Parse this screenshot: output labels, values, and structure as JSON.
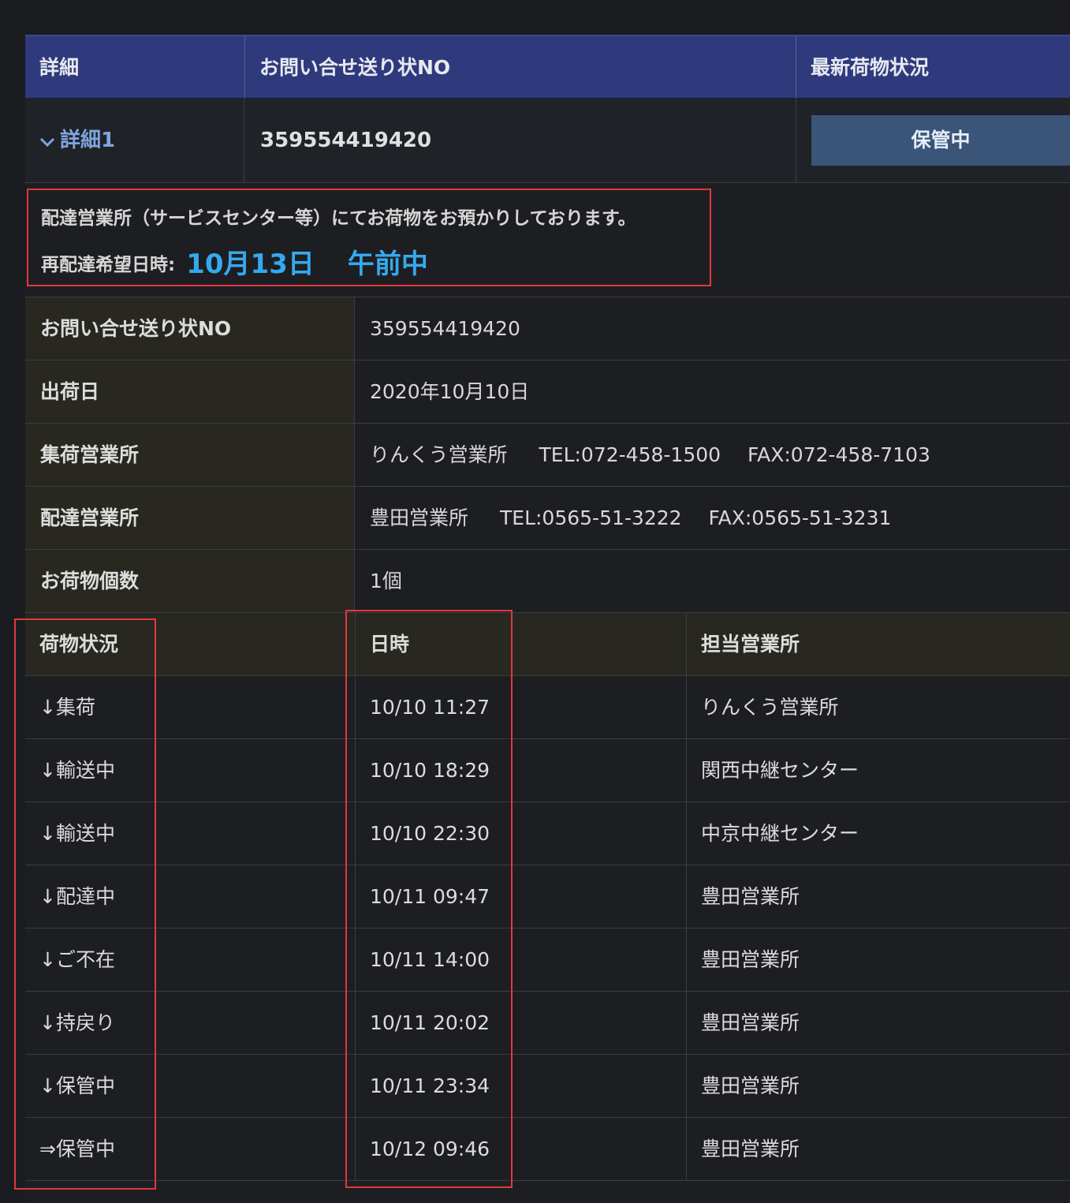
{
  "header": {
    "col_detail": "詳細",
    "col_invoice": "お問い合せ送り状NO",
    "col_status": "最新荷物状況"
  },
  "summary_row": {
    "detail_link": "詳細1",
    "invoice_no": "359554419420",
    "status_button": "保管中"
  },
  "notice": {
    "message": "配達営業所（サービスセンター等）にてお荷物をお預かりしております。",
    "redelivery_label": "再配達希望日時:",
    "redelivery_date": "10月13日",
    "redelivery_time": "午前中"
  },
  "info": {
    "invoice": {
      "label": "お問い合せ送り状NO",
      "value": "359554419420"
    },
    "ship_date": {
      "label": "出荷日",
      "value": "2020年10月10日"
    },
    "pickup_office": {
      "label": "集荷営業所",
      "name": "りんくう営業所",
      "tel": "TEL:072-458-1500",
      "fax": "FAX:072-458-7103"
    },
    "delivery_office": {
      "label": "配達営業所",
      "name": "豊田営業所",
      "tel": "TEL:0565-51-3222",
      "fax": "FAX:0565-51-3231"
    },
    "count": {
      "label": "お荷物個数",
      "value": "1個"
    }
  },
  "tracking": {
    "headers": [
      "荷物状況",
      "日時",
      "担当営業所"
    ],
    "rows": [
      [
        "↓集荷",
        "10/10 11:27",
        "りんくう営業所"
      ],
      [
        "↓輸送中",
        "10/10 18:29",
        "関西中継センター"
      ],
      [
        "↓輸送中",
        "10/10 22:30",
        "中京中継センター"
      ],
      [
        "↓配達中",
        "10/11 09:47",
        "豊田営業所"
      ],
      [
        "↓ご不在",
        "10/11 14:00",
        "豊田営業所"
      ],
      [
        "↓持戻り",
        "10/11 20:02",
        "豊田営業所"
      ],
      [
        "↓保管中",
        "10/11 23:34",
        "豊田営業所"
      ],
      [
        "⇒保管中",
        "10/12 09:46",
        "豊田営業所"
      ]
    ]
  }
}
